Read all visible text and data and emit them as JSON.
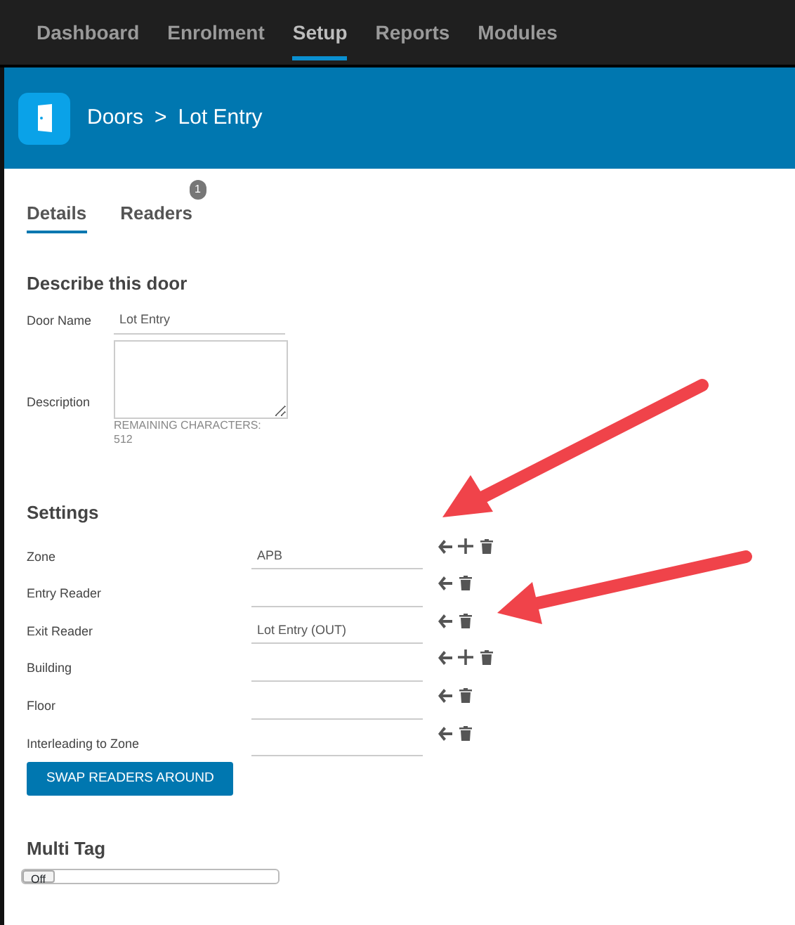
{
  "nav": [
    {
      "label": "Dashboard",
      "selected": false
    },
    {
      "label": "Enrolment",
      "selected": false
    },
    {
      "label": "Setup",
      "selected": true
    },
    {
      "label": "Reports",
      "selected": false
    },
    {
      "label": "Modules",
      "selected": false
    }
  ],
  "header": {
    "breadcrumb": "Doors",
    "separator": ">",
    "title": "Lot Entry"
  },
  "tabs": [
    {
      "label": "Details",
      "selected": true
    },
    {
      "label": "Readers",
      "selected": false,
      "badge": "1"
    }
  ],
  "describe": {
    "heading": "Describe this door",
    "door_name_label": "Door Name",
    "door_name_value": "Lot Entry",
    "description_label": "Description",
    "remaining": "REMAINING CHARACTERS:",
    "remaining_count": "512"
  },
  "settings": {
    "heading": "Settings",
    "rows": [
      {
        "label": "Zone",
        "value": "APB",
        "can_add": true
      },
      {
        "label": "Entry Reader",
        "can_add": false
      },
      {
        "label": "Exit Reader",
        "value": "Lot Entry (OUT)",
        "can_add": false
      },
      {
        "label": "Building",
        "can_add": true
      },
      {
        "label": "Floor",
        "can_add": false
      },
      {
        "label": "Interleading to Zone",
        "can_add": false
      }
    ],
    "swap_button": "SWAP READERS AROUND"
  },
  "multi_tag": {
    "heading": "Multi Tag",
    "toggle_label": "Off",
    "on": false
  }
}
